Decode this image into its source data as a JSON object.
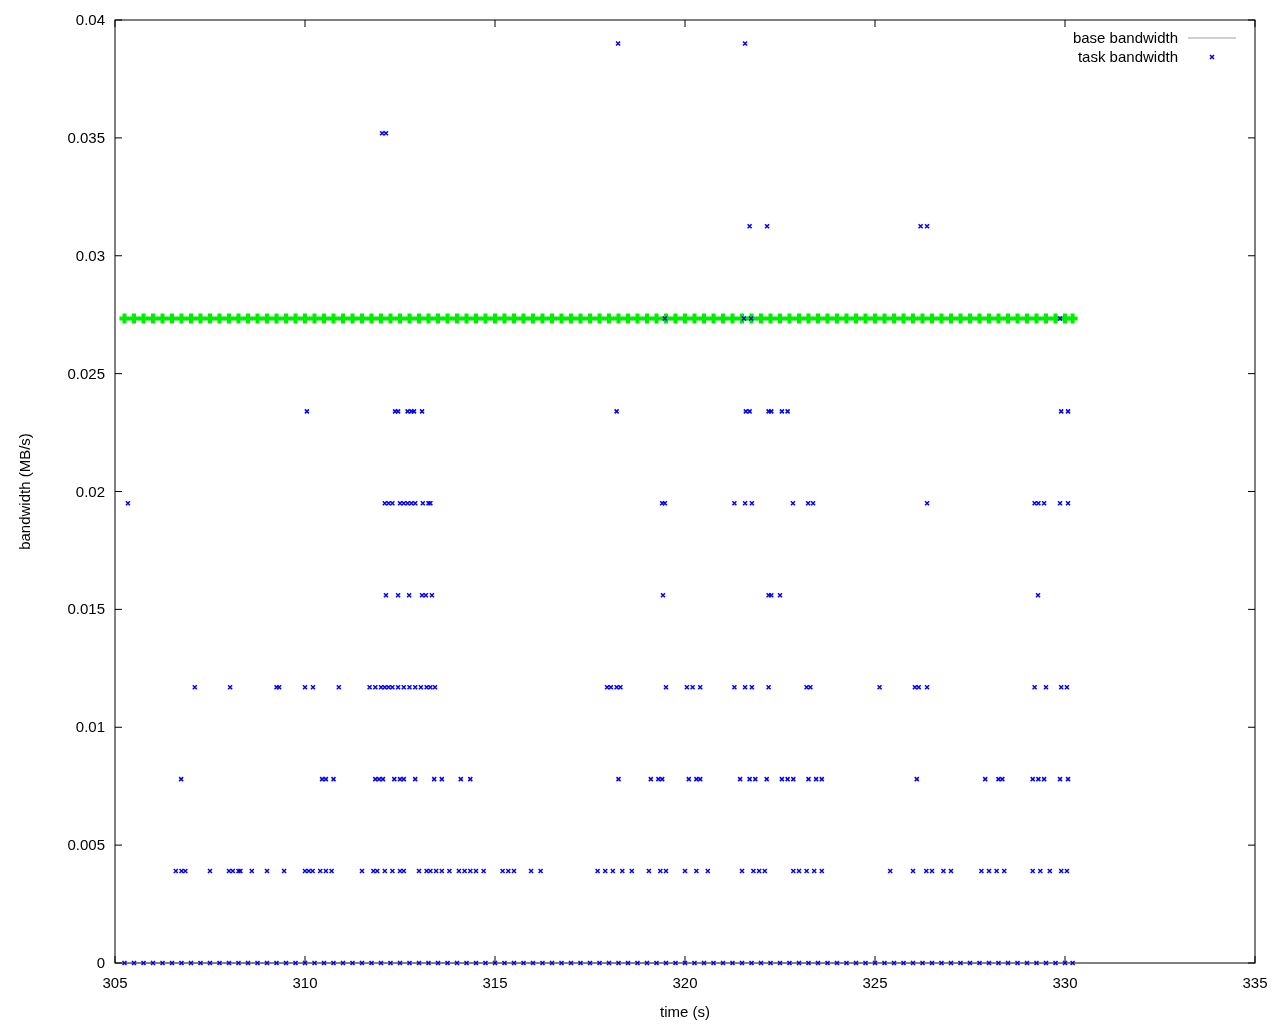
{
  "chart_data": {
    "type": "scatter",
    "xlabel": "time (s)",
    "ylabel": "bandwidth (MB/s)",
    "xlim": [
      305,
      335
    ],
    "ylim": [
      0,
      0.04
    ],
    "xticks": [
      305,
      310,
      315,
      320,
      325,
      330,
      335
    ],
    "yticks": [
      0,
      0.005,
      0.01,
      0.015,
      0.02,
      0.025,
      0.03,
      0.035,
      0.04
    ],
    "series": [
      {
        "name": "base bandwidth",
        "color": "#00ee00",
        "x": [
          305.25,
          305.5,
          305.75,
          306,
          306.25,
          306.5,
          306.75,
          307,
          307.25,
          307.5,
          307.75,
          308,
          308.25,
          308.5,
          308.75,
          309,
          309.25,
          309.5,
          309.75,
          310,
          310.25,
          310.5,
          310.75,
          311,
          311.25,
          311.5,
          311.75,
          312,
          312.25,
          312.5,
          312.75,
          313,
          313.25,
          313.5,
          313.75,
          314,
          314.25,
          314.5,
          314.75,
          315,
          315.25,
          315.5,
          315.75,
          316,
          316.25,
          316.5,
          316.75,
          317,
          317.25,
          317.5,
          317.75,
          318,
          318.25,
          318.5,
          318.75,
          319,
          319.25,
          319.5,
          319.75,
          320,
          320.25,
          320.5,
          320.75,
          321,
          321.25,
          321.5,
          321.75,
          322,
          322.25,
          322.5,
          322.75,
          323,
          323.25,
          323.5,
          323.75,
          324,
          324.25,
          324.5,
          324.75,
          325,
          325.25,
          325.5,
          325.75,
          326,
          326.25,
          326.5,
          326.75,
          327,
          327.25,
          327.5,
          327.75,
          328,
          328.25,
          328.5,
          328.75,
          329,
          329.25,
          329.5,
          329.75,
          330,
          330.2
        ],
        "values": [
          0.02734,
          0.02734,
          0.02734,
          0.02734,
          0.02734,
          0.02734,
          0.02734,
          0.02734,
          0.02734,
          0.02734,
          0.02734,
          0.02734,
          0.02734,
          0.02734,
          0.02734,
          0.02734,
          0.02734,
          0.02734,
          0.02734,
          0.02734,
          0.02734,
          0.02734,
          0.02734,
          0.02734,
          0.02734,
          0.02734,
          0.02734,
          0.02734,
          0.02734,
          0.02734,
          0.02734,
          0.02734,
          0.02734,
          0.02734,
          0.02734,
          0.02734,
          0.02734,
          0.02734,
          0.02734,
          0.02734,
          0.02734,
          0.02734,
          0.02734,
          0.02734,
          0.02734,
          0.02734,
          0.02734,
          0.02734,
          0.02734,
          0.02734,
          0.02734,
          0.02734,
          0.02734,
          0.02734,
          0.02734,
          0.02734,
          0.02734,
          0.02734,
          0.02734,
          0.02734,
          0.02734,
          0.02734,
          0.02734,
          0.02734,
          0.02734,
          0.02734,
          0.02734,
          0.02734,
          0.02734,
          0.02734,
          0.02734,
          0.02734,
          0.02734,
          0.02734,
          0.02734,
          0.02734,
          0.02734,
          0.02734,
          0.02734,
          0.02734,
          0.02734,
          0.02734,
          0.02734,
          0.02734,
          0.02734,
          0.02734,
          0.02734,
          0.02734,
          0.02734,
          0.02734,
          0.02734,
          0.02734,
          0.02734,
          0.02734,
          0.02734,
          0.02734,
          0.02734,
          0.02734,
          0.02734,
          0.02734,
          0.02734
        ]
      },
      {
        "name": "task bandwidth",
        "color": "#0000ff",
        "x": [
          318.24,
          321.58,
          312.03,
          312.13,
          321.7,
          322.16,
          326.2,
          326.37,
          319.47,
          321.55,
          321.74,
          329.87,
          310.05,
          312.37,
          312.45,
          312.7,
          312.8,
          312.87,
          313.08,
          318.2,
          321.6,
          321.7,
          322.2,
          322.27,
          322.55,
          322.7,
          329.9,
          330.08,
          305.34,
          312.1,
          312.2,
          312.3,
          312.5,
          312.6,
          312.7,
          312.8,
          312.9,
          313.1,
          313.25,
          313.3,
          319.4,
          319.47,
          321.3,
          321.58,
          321.76,
          322.84,
          323.24,
          323.37,
          326.37,
          329.2,
          329.3,
          329.45,
          329.87,
          330.08,
          312.13,
          312.45,
          312.74,
          313.08,
          313.18,
          313.34,
          319.42,
          322.2,
          322.27,
          322.5,
          329.29,
          307.1,
          308.03,
          309.25,
          309.32,
          310.0,
          310.21,
          310.89,
          311.7,
          311.85,
          312.0,
          312.1,
          312.2,
          312.3,
          312.45,
          312.6,
          312.75,
          312.9,
          313.05,
          313.2,
          313.3,
          313.42,
          317.95,
          318.05,
          318.2,
          318.3,
          319.5,
          320.05,
          320.2,
          320.4,
          321.3,
          321.58,
          321.76,
          322.2,
          323.2,
          323.3,
          325.12,
          326.05,
          326.15,
          326.37,
          329.2,
          329.5,
          329.9,
          330.05,
          306.74,
          310.45,
          310.55,
          310.75,
          311.85,
          311.95,
          312.05,
          312.35,
          312.5,
          312.6,
          312.9,
          313.4,
          313.6,
          314.1,
          314.35,
          318.25,
          319.1,
          319.3,
          319.4,
          320.1,
          320.3,
          320.4,
          321.45,
          321.7,
          321.85,
          322.15,
          322.55,
          322.7,
          322.85,
          323.25,
          323.45,
          323.6,
          326.1,
          327.9,
          328.25,
          328.35,
          329.15,
          329.3,
          329.45,
          329.87,
          330.08,
          306.6,
          306.75,
          306.85,
          307.5,
          308.0,
          308.1,
          308.25,
          308.3,
          308.6,
          309.0,
          309.45,
          310.0,
          310.1,
          310.2,
          310.4,
          310.55,
          310.7,
          311.5,
          311.8,
          311.9,
          312.1,
          312.3,
          312.5,
          312.6,
          313.0,
          313.2,
          313.3,
          313.45,
          313.6,
          313.8,
          314.05,
          314.2,
          314.35,
          314.5,
          314.7,
          315.2,
          315.35,
          315.5,
          315.95,
          316.2,
          317.7,
          317.9,
          318.1,
          318.35,
          318.6,
          319.05,
          319.35,
          319.5,
          320.0,
          320.3,
          320.6,
          321.5,
          321.8,
          321.95,
          322.1,
          322.85,
          323.0,
          323.2,
          323.4,
          323.6,
          325.4,
          326.0,
          326.35,
          326.5,
          326.8,
          327.0,
          327.8,
          328.0,
          328.2,
          328.4,
          329.15,
          329.35,
          329.6,
          329.9,
          330.05,
          305.25,
          305.5,
          305.75,
          306,
          306.25,
          306.5,
          306.75,
          307,
          307.25,
          307.5,
          307.75,
          308,
          308.25,
          308.5,
          308.75,
          309,
          309.25,
          309.5,
          309.75,
          310,
          310.25,
          310.5,
          310.75,
          311,
          311.25,
          311.5,
          311.75,
          312,
          312.25,
          312.5,
          312.75,
          313,
          313.25,
          313.5,
          313.75,
          314,
          314.25,
          314.5,
          314.75,
          315,
          315.25,
          315.5,
          315.75,
          316,
          316.25,
          316.5,
          316.75,
          317,
          317.25,
          317.5,
          317.75,
          318,
          318.25,
          318.5,
          318.75,
          319,
          319.25,
          319.5,
          319.75,
          320,
          320.25,
          320.5,
          320.75,
          321,
          321.25,
          321.5,
          321.75,
          322,
          322.25,
          322.5,
          322.75,
          323,
          323.25,
          323.5,
          323.75,
          324,
          324.25,
          324.5,
          324.75,
          325,
          325.25,
          325.5,
          325.75,
          326,
          326.25,
          326.5,
          326.75,
          327,
          327.25,
          327.5,
          327.75,
          328,
          328.25,
          328.5,
          328.75,
          329,
          329.25,
          329.5,
          329.75,
          330,
          330.2
        ],
        "values": [
          0.039,
          0.039,
          0.0352,
          0.0352,
          0.03125,
          0.03125,
          0.03125,
          0.03125,
          0.02734,
          0.02734,
          0.02734,
          0.02734,
          0.0234,
          0.0234,
          0.0234,
          0.0234,
          0.0234,
          0.0234,
          0.0234,
          0.0234,
          0.0234,
          0.0234,
          0.0234,
          0.0234,
          0.0234,
          0.0234,
          0.0234,
          0.0234,
          0.0195,
          0.0195,
          0.0195,
          0.0195,
          0.0195,
          0.0195,
          0.0195,
          0.0195,
          0.0195,
          0.0195,
          0.0195,
          0.0195,
          0.0195,
          0.0195,
          0.0195,
          0.0195,
          0.0195,
          0.0195,
          0.0195,
          0.0195,
          0.0195,
          0.0195,
          0.0195,
          0.0195,
          0.0195,
          0.0195,
          0.0156,
          0.0156,
          0.0156,
          0.0156,
          0.0156,
          0.0156,
          0.0156,
          0.0156,
          0.0156,
          0.0156,
          0.0156,
          0.0117,
          0.0117,
          0.0117,
          0.0117,
          0.0117,
          0.0117,
          0.0117,
          0.0117,
          0.0117,
          0.0117,
          0.0117,
          0.0117,
          0.0117,
          0.0117,
          0.0117,
          0.0117,
          0.0117,
          0.0117,
          0.0117,
          0.0117,
          0.0117,
          0.0117,
          0.0117,
          0.0117,
          0.0117,
          0.0117,
          0.0117,
          0.0117,
          0.0117,
          0.0117,
          0.0117,
          0.0117,
          0.0117,
          0.0117,
          0.0117,
          0.0117,
          0.0117,
          0.0117,
          0.0117,
          0.0117,
          0.0117,
          0.0117,
          0.0117,
          0.0078,
          0.0078,
          0.0078,
          0.0078,
          0.0078,
          0.0078,
          0.0078,
          0.0078,
          0.0078,
          0.0078,
          0.0078,
          0.0078,
          0.0078,
          0.0078,
          0.0078,
          0.0078,
          0.0078,
          0.0078,
          0.0078,
          0.0078,
          0.0078,
          0.0078,
          0.0078,
          0.0078,
          0.0078,
          0.0078,
          0.0078,
          0.0078,
          0.0078,
          0.0078,
          0.0078,
          0.0078,
          0.0078,
          0.0078,
          0.0078,
          0.0078,
          0.0078,
          0.0078,
          0.0078,
          0.0078,
          0.0078,
          0.0039,
          0.0039,
          0.0039,
          0.0039,
          0.0039,
          0.0039,
          0.0039,
          0.0039,
          0.0039,
          0.0039,
          0.0039,
          0.0039,
          0.0039,
          0.0039,
          0.0039,
          0.0039,
          0.0039,
          0.0039,
          0.0039,
          0.0039,
          0.0039,
          0.0039,
          0.0039,
          0.0039,
          0.0039,
          0.0039,
          0.0039,
          0.0039,
          0.0039,
          0.0039,
          0.0039,
          0.0039,
          0.0039,
          0.0039,
          0.0039,
          0.0039,
          0.0039,
          0.0039,
          0.0039,
          0.0039,
          0.0039,
          0.0039,
          0.0039,
          0.0039,
          0.0039,
          0.0039,
          0.0039,
          0.0039,
          0.0039,
          0.0039,
          0.0039,
          0.0039,
          0.0039,
          0.0039,
          0.0039,
          0.0039,
          0.0039,
          0.0039,
          0.0039,
          0.0039,
          0.0039,
          0.0039,
          0.0039,
          0.0039,
          0.0039,
          0.0039,
          0.0039,
          0.0039,
          0.0039,
          0.0039,
          0.0039,
          0.0039,
          0.0039,
          0.0039,
          0.0039,
          0,
          0,
          0,
          0,
          0,
          0,
          0,
          0,
          0,
          0,
          0,
          0,
          0,
          0,
          0,
          0,
          0,
          0,
          0,
          0,
          0,
          0,
          0,
          0,
          0,
          0,
          0,
          0,
          0,
          0,
          0,
          0,
          0,
          0,
          0,
          0,
          0,
          0,
          0,
          0,
          0,
          0,
          0,
          0,
          0,
          0,
          0,
          0,
          0,
          0,
          0,
          0,
          0,
          0,
          0,
          0,
          0,
          0,
          0,
          0,
          0,
          0,
          0,
          0,
          0,
          0,
          0,
          0,
          0,
          0,
          0,
          0,
          0,
          0,
          0,
          0,
          0,
          0,
          0,
          0,
          0,
          0,
          0,
          0,
          0,
          0,
          0,
          0,
          0,
          0,
          0,
          0,
          0,
          0,
          0,
          0,
          0,
          0,
          0,
          0,
          0
        ]
      }
    ]
  }
}
